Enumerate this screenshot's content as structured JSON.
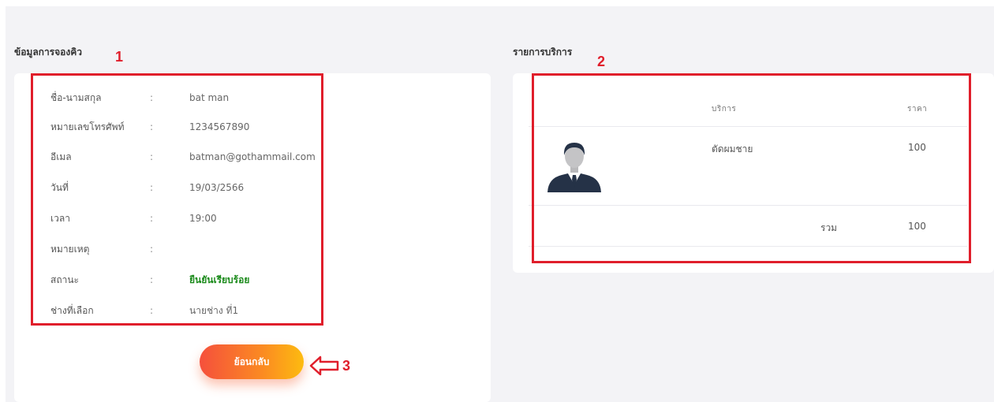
{
  "booking_info": {
    "title": "ข้อมูลการจองคิว",
    "rows": [
      {
        "label": "ชื่อ-นามสกุล",
        "sep": ":",
        "value": "bat man"
      },
      {
        "label": "หมายเลขโทรศัพท์",
        "sep": ":",
        "value": "1234567890"
      },
      {
        "label": "อีเมล",
        "sep": ":",
        "value": "batman@gothammail.com"
      },
      {
        "label": "วันที่",
        "sep": ":",
        "value": "19/03/2566"
      },
      {
        "label": "เวลา",
        "sep": ":",
        "value": "19:00"
      },
      {
        "label": "หมายเหตุ",
        "sep": ":",
        "value": ""
      },
      {
        "label": "สถานะ",
        "sep": ":",
        "value": "ยืนยันเรียบร้อย"
      },
      {
        "label": "ช่างที่เลือก",
        "sep": ":",
        "value": "นายช่าง ที่1"
      }
    ],
    "back_button": "ย้อนกลับ"
  },
  "services": {
    "title": "รายการบริการ",
    "headers": {
      "service": "บริการ",
      "price": "ราคา"
    },
    "items": [
      {
        "name": "ตัดผมชาย",
        "price": "100",
        "icon": "person-avatar-icon"
      }
    ],
    "total_label": "รวม",
    "total_value": "100"
  },
  "annotations": {
    "n1": "1",
    "n2": "2",
    "n3": "3"
  },
  "colors": {
    "highlight": "#e01e2b",
    "status": "#1a8a1a",
    "button_gradient": [
      "#f5503c",
      "#fdbb10"
    ]
  }
}
